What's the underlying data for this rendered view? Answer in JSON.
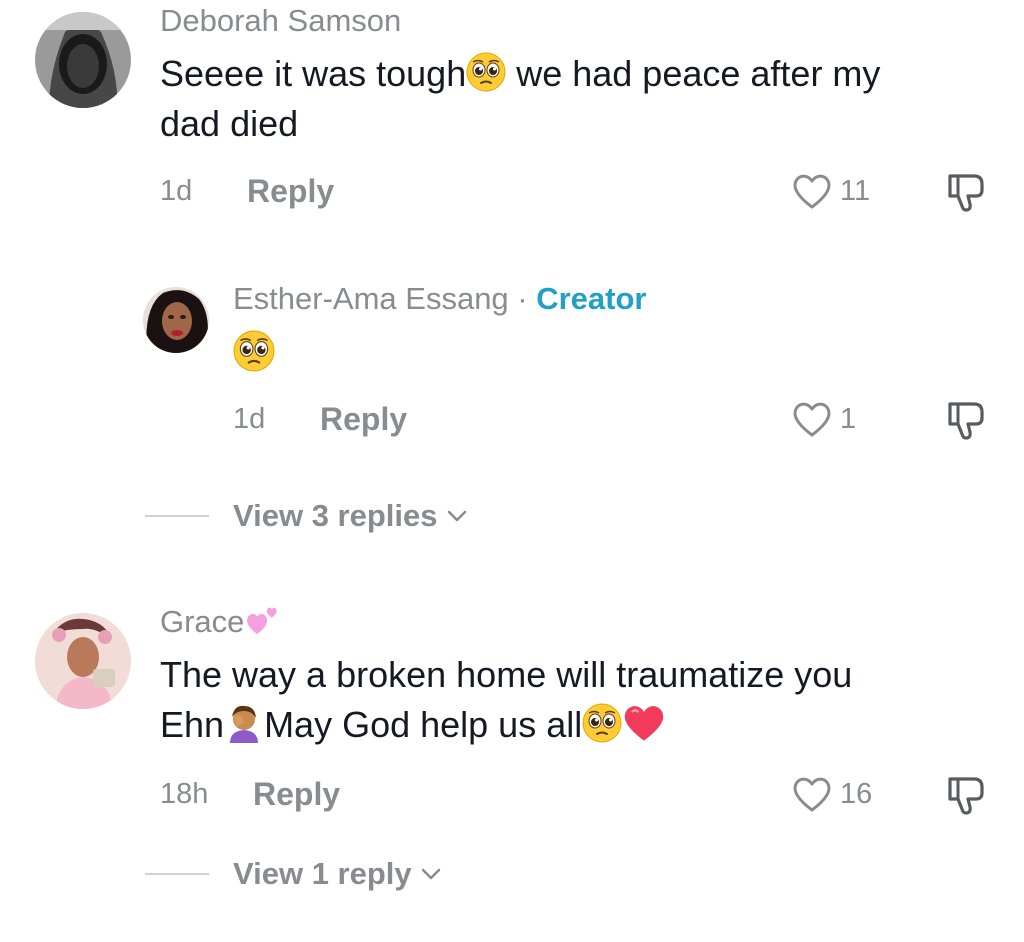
{
  "comments": [
    {
      "username": "Deborah Samson",
      "text_line1_a": "Seeee it was tough",
      "text_line1_b": " we had peace after my",
      "text_line2": "dad died",
      "time": "1d",
      "reply_label": "Reply",
      "likes": "11",
      "icons": [
        "pleading-face-emoji",
        "heart-outline-icon",
        "thumbs-down-icon"
      ]
    },
    {
      "username": "Esther-Ama Essang",
      "separator": " · ",
      "badge": "Creator",
      "text_emoji": "pleading-face-emoji",
      "time": "1d",
      "reply_label": "Reply",
      "likes": "1",
      "view_replies": "View 3 replies"
    },
    {
      "username": "Grace",
      "username_emoji": "growing-heart-emoji",
      "text_line1": "The way a broken home will traumatize you",
      "text_line2_a": "Ehn",
      "text_line2_b": "May God help us all",
      "time": "18h",
      "reply_label": "Reply",
      "likes": "16",
      "view_replies": "View 1 reply"
    }
  ],
  "colors": {
    "text": "#161823",
    "secondary": "#8a8b91",
    "creator": "#20a0c4"
  }
}
